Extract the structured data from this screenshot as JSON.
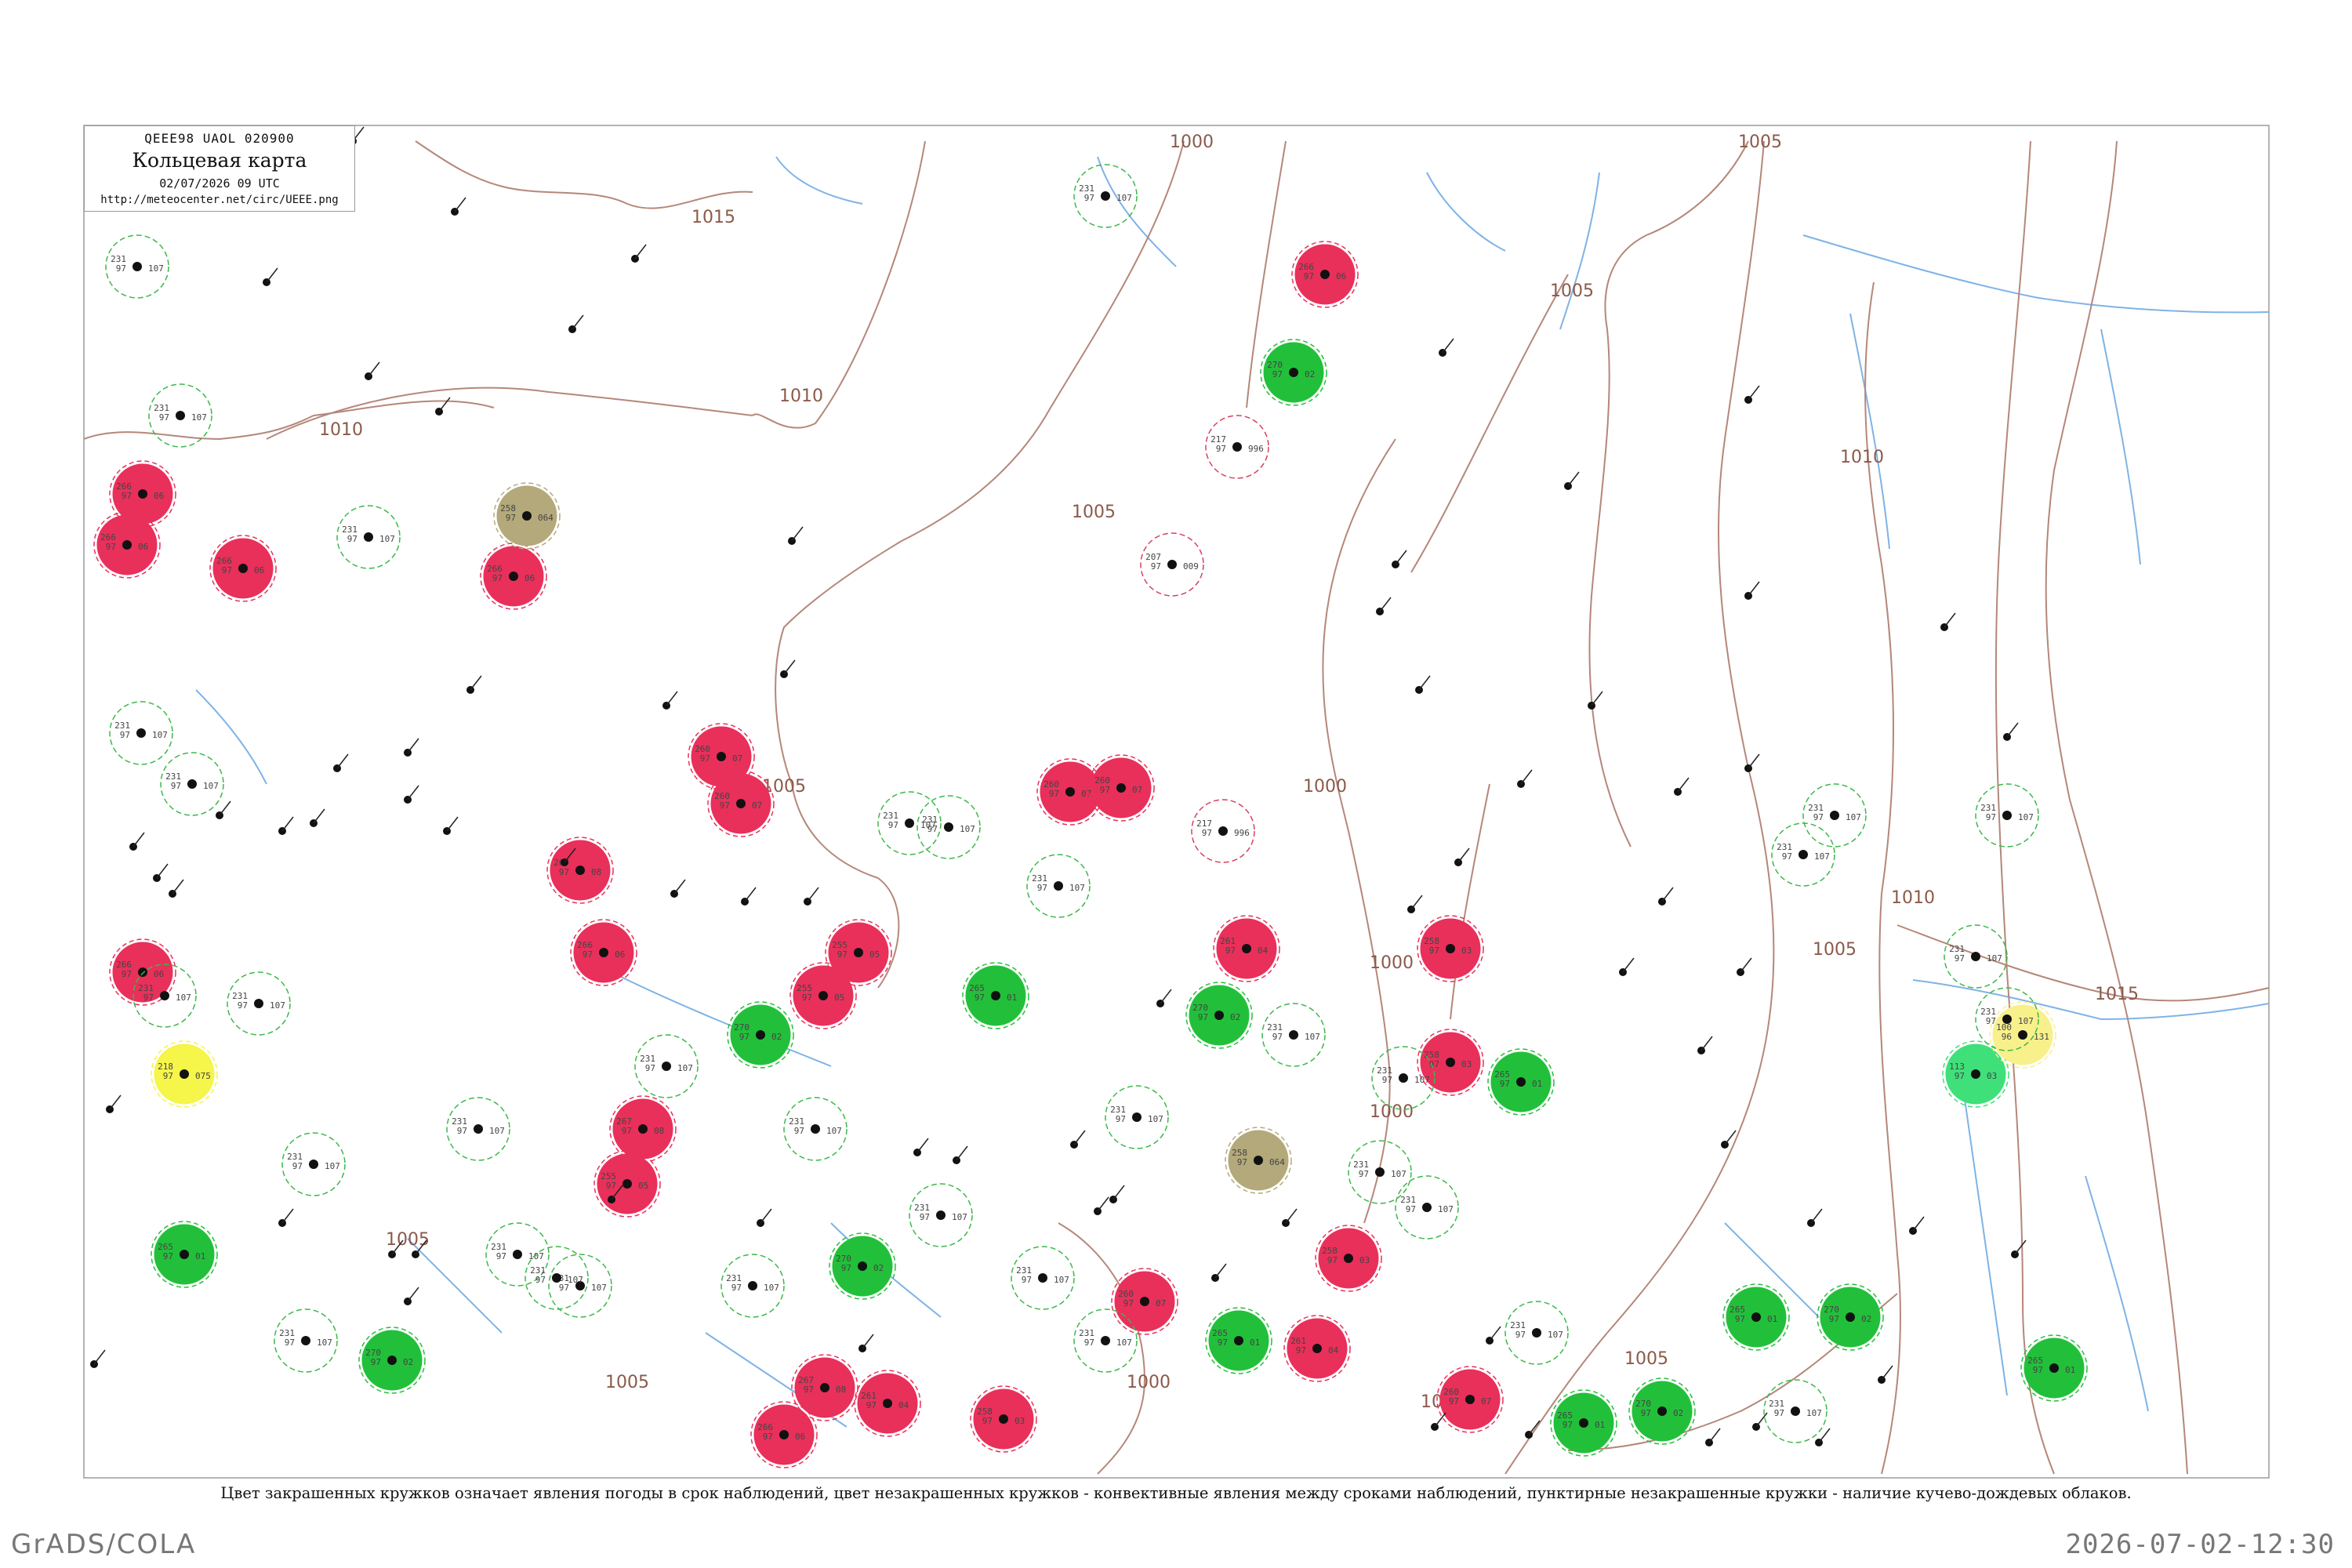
{
  "legend": {
    "code_line": "QEEE98  UAOL  020900",
    "title": "Кольцевая карта",
    "datetime": "02/07/2026 09 UTC",
    "url": "http://meteocenter.net/circ/UEEE.png"
  },
  "caption": "Цвет закрашенных кружков означает явления погоды в срок наблюдений, цвет незакрашенных кружков - конвективные явления между сроками наблюдений, пунктирные незакрашенные кружки - наличие кучево-дождевых облаков.",
  "footer": {
    "left": "GrADS/COLA",
    "right": "2026-07-02-12:30"
  },
  "isobar_labels": [
    "1000",
    "1005",
    "1010",
    "1015"
  ],
  "colors": {
    "isobar": "#b5877a",
    "river": "#7fb3e6",
    "thunder_red": "#e8305a",
    "rain_green": "#22c03a",
    "fog_yellow": "#f5f54a",
    "haze_olive": "#b3a97a",
    "drizzle_lightgreen": "#3fe07a",
    "pale_yellow": "#f8f08a",
    "convective_ring_red": "#d84060",
    "cb_ring_green": "#3cb84a"
  },
  "stations": [
    {
      "t": "filled",
      "c": "thunder_red",
      "p": "266",
      "v": "97",
      "d": "06"
    },
    {
      "t": "filled",
      "c": "thunder_red",
      "p": "260",
      "v": "97",
      "d": "07"
    },
    {
      "t": "filled",
      "c": "thunder_red",
      "p": "255",
      "v": "97",
      "d": "05"
    },
    {
      "t": "filled",
      "c": "thunder_red",
      "p": "267",
      "v": "97",
      "d": "08"
    },
    {
      "t": "filled",
      "c": "thunder_red",
      "p": "261",
      "v": "97",
      "d": "04"
    },
    {
      "t": "filled",
      "c": "thunder_red",
      "p": "258",
      "v": "97",
      "d": "03"
    },
    {
      "t": "filled",
      "c": "rain_green",
      "p": "270",
      "v": "97",
      "d": "02"
    },
    {
      "t": "filled",
      "c": "rain_green",
      "p": "265",
      "v": "97",
      "d": "01"
    },
    {
      "t": "filled",
      "c": "fog_yellow",
      "p": "218",
      "v": "97",
      "d": "075"
    },
    {
      "t": "filled",
      "c": "haze_olive",
      "p": "258",
      "v": "97",
      "d": "064"
    },
    {
      "t": "filled",
      "c": "drizzle_lightgreen",
      "p": "113",
      "v": "97",
      "d": "03"
    },
    {
      "t": "filled",
      "c": "pale_yellow",
      "p": "100",
      "v": "96",
      "d": "131"
    },
    {
      "t": "ring",
      "c": "cb_ring_green",
      "p": "231",
      "v": "97",
      "d": "107"
    },
    {
      "t": "ring",
      "c": "convective_ring_red",
      "p": "217",
      "v": "97",
      "d": "996"
    },
    {
      "t": "ring",
      "c": "convective_ring_red",
      "p": "207",
      "v": "97",
      "d": "009"
    }
  ]
}
